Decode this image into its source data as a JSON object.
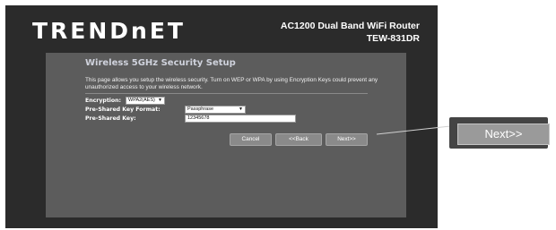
{
  "header": {
    "logo": "TRENDnET",
    "product_line": "AC1200 Dual Band WiFi Router",
    "model": "TEW-831DR"
  },
  "panel": {
    "title": "Wireless 5GHz Security Setup",
    "description": "This page allows you setup the wireless security. Turn on WEP or WPA by using Encryption Keys could prevent any unauthorized access to your wireless network."
  },
  "form": {
    "encryption_label": "Encryption:",
    "encryption_value": "WPA2(AES)",
    "psk_format_label": "Pre-Shared Key Format:",
    "psk_format_value": "Passphrase",
    "psk_label": "Pre-Shared Key:",
    "psk_value": "12345678"
  },
  "buttons": {
    "cancel": "Cancel",
    "back": "<<Back",
    "next": "Next>>"
  },
  "callout": {
    "label": "Next>>"
  },
  "icons": {
    "dropdown": "chevron-down-icon"
  },
  "colors": {
    "frame_bg": "#2b2b2b",
    "panel_bg": "#5c5c5c",
    "button_bg": "#8a8a8a",
    "callout_bg": "#444444"
  }
}
